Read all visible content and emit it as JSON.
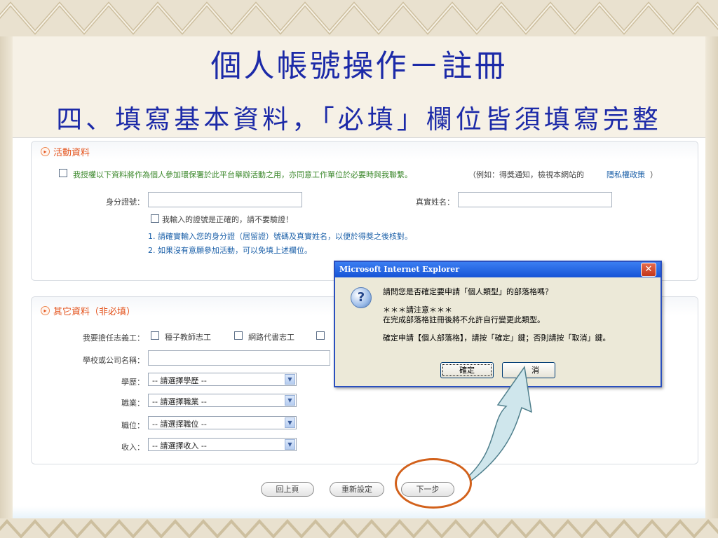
{
  "slide": {
    "title": "個人帳號操作－註冊",
    "subtitle": "四、填寫基本資料，「必填」欄位皆須填寫完整"
  },
  "activity_section": {
    "title": "活動資料",
    "consent_text": "我授權以下資料將作為個人參加環保署於此平台舉辦活動之用，亦同意工作單位於必要時與我聯繫。",
    "consent_example": "（例如：得獎通知，檢視本網站的",
    "privacy_link": "隱私權政策",
    "consent_close": "）",
    "id_label": "身分證號：",
    "id_value": "",
    "realname_label": "真實姓名：",
    "realname_value": "",
    "id_confirm_text": "我輸入的證號是正確的，請不要驗證！",
    "note_1": "1. 請確實輸入您的身分證（居留證）號碼及真實姓名，以便於得獎之後核對。",
    "note_2": "2. 如果沒有意願參加活動，可以免填上述欄位。"
  },
  "other_section": {
    "title": "其它資料（非必填）",
    "volunteer_label": "我要擔任志義工：",
    "volunteer_opt_1": "種子教師志工",
    "volunteer_opt_2": "網路代書志工",
    "school_label": "學校或公司名稱：",
    "school_value": "",
    "education_label": "學歷：",
    "education_value": "-- 請選擇學歷 --",
    "occupation_label": "職業：",
    "occupation_value": "-- 請選擇職業 --",
    "position_label": "職位：",
    "position_value": "-- 請選擇職位 --",
    "income_label": "收入：",
    "income_value": "-- 請選擇收入 --"
  },
  "buttons": {
    "back": "回上頁",
    "reset": "重新設定",
    "next": "下一步"
  },
  "dialog": {
    "title": "Microsoft Internet Explorer",
    "line_1": "請問您是否確定要申請「個人類型」的部落格嗎？",
    "line_2": "＊＊＊請注意＊＊＊",
    "line_3": "在完成部落格註冊後將不允許自行變更此類型。",
    "line_4": "確定申請【個人部落格】，請按「確定」鍵；否則請按「取消」鍵。",
    "ok": "確定",
    "cancel": "消"
  },
  "colors": {
    "slide_title": "#1c2aa8",
    "section_title": "#e4521b",
    "consent_text": "#3f8a2f",
    "note_text": "#1a5fa8",
    "highlight": "#d2611b"
  }
}
